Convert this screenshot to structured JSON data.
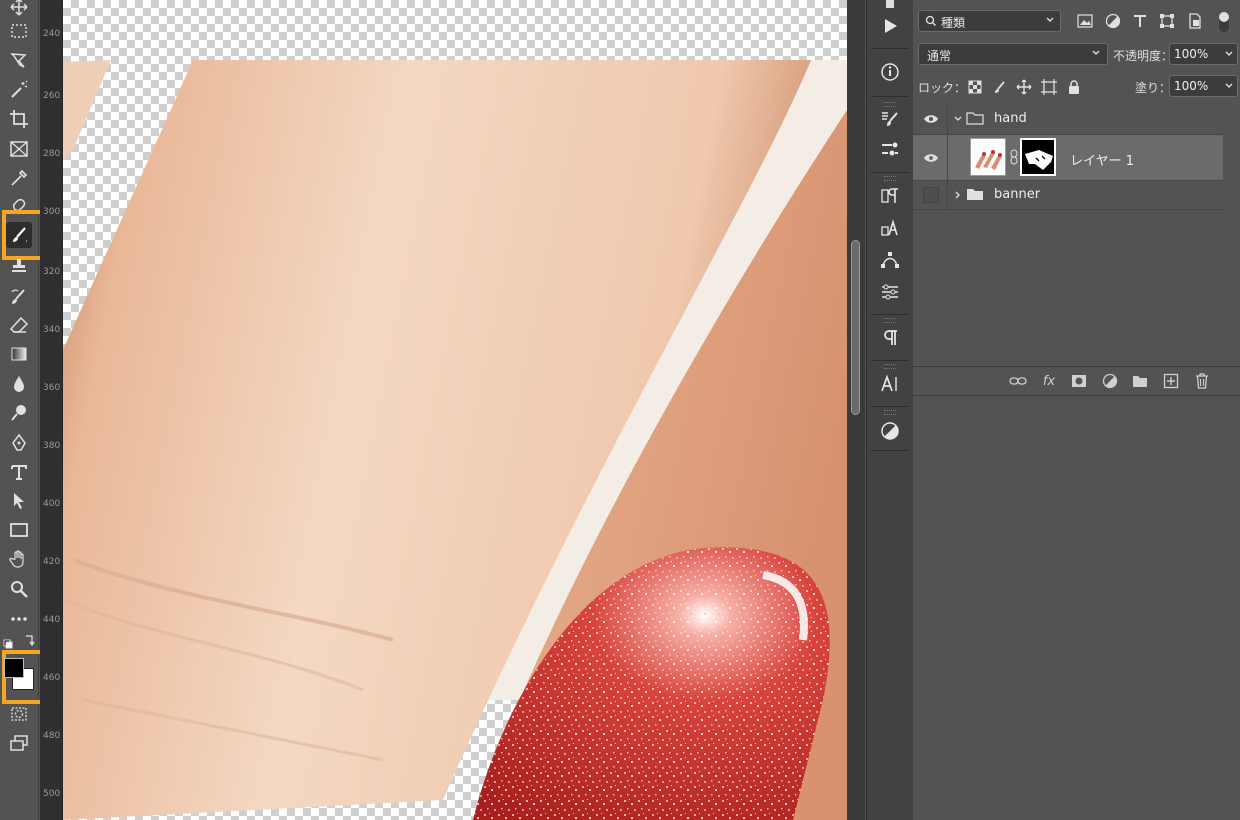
{
  "layers_panel": {
    "filter_kind": "種類",
    "blend_mode": "通常",
    "opacity_label": "不透明度：",
    "opacity_value": "100%",
    "lock_label": "ロック：",
    "fill_label": "塗り：",
    "fill_value": "100%",
    "layers": [
      {
        "name": "hand",
        "type": "group",
        "visible": true,
        "expanded": true
      },
      {
        "name": "レイヤー 1",
        "type": "layer",
        "visible": true,
        "selected": true,
        "has_mask": true
      },
      {
        "name": "banner",
        "type": "group",
        "visible": false,
        "expanded": false
      }
    ],
    "bottom_bar": {
      "fx_label": "fx"
    }
  },
  "ruler": {
    "labels": [
      "240",
      "260",
      "280",
      "300",
      "320",
      "340",
      "360",
      "380",
      "400",
      "420",
      "440",
      "460",
      "480",
      "500"
    ]
  },
  "tools": {
    "active_tool": "brush-tool",
    "foreground_color": "#000000",
    "background_color": "#ffffff"
  },
  "colors": {
    "highlight": "#f5a623",
    "nail": "#c8302c",
    "skin": "#f0cdb2"
  }
}
